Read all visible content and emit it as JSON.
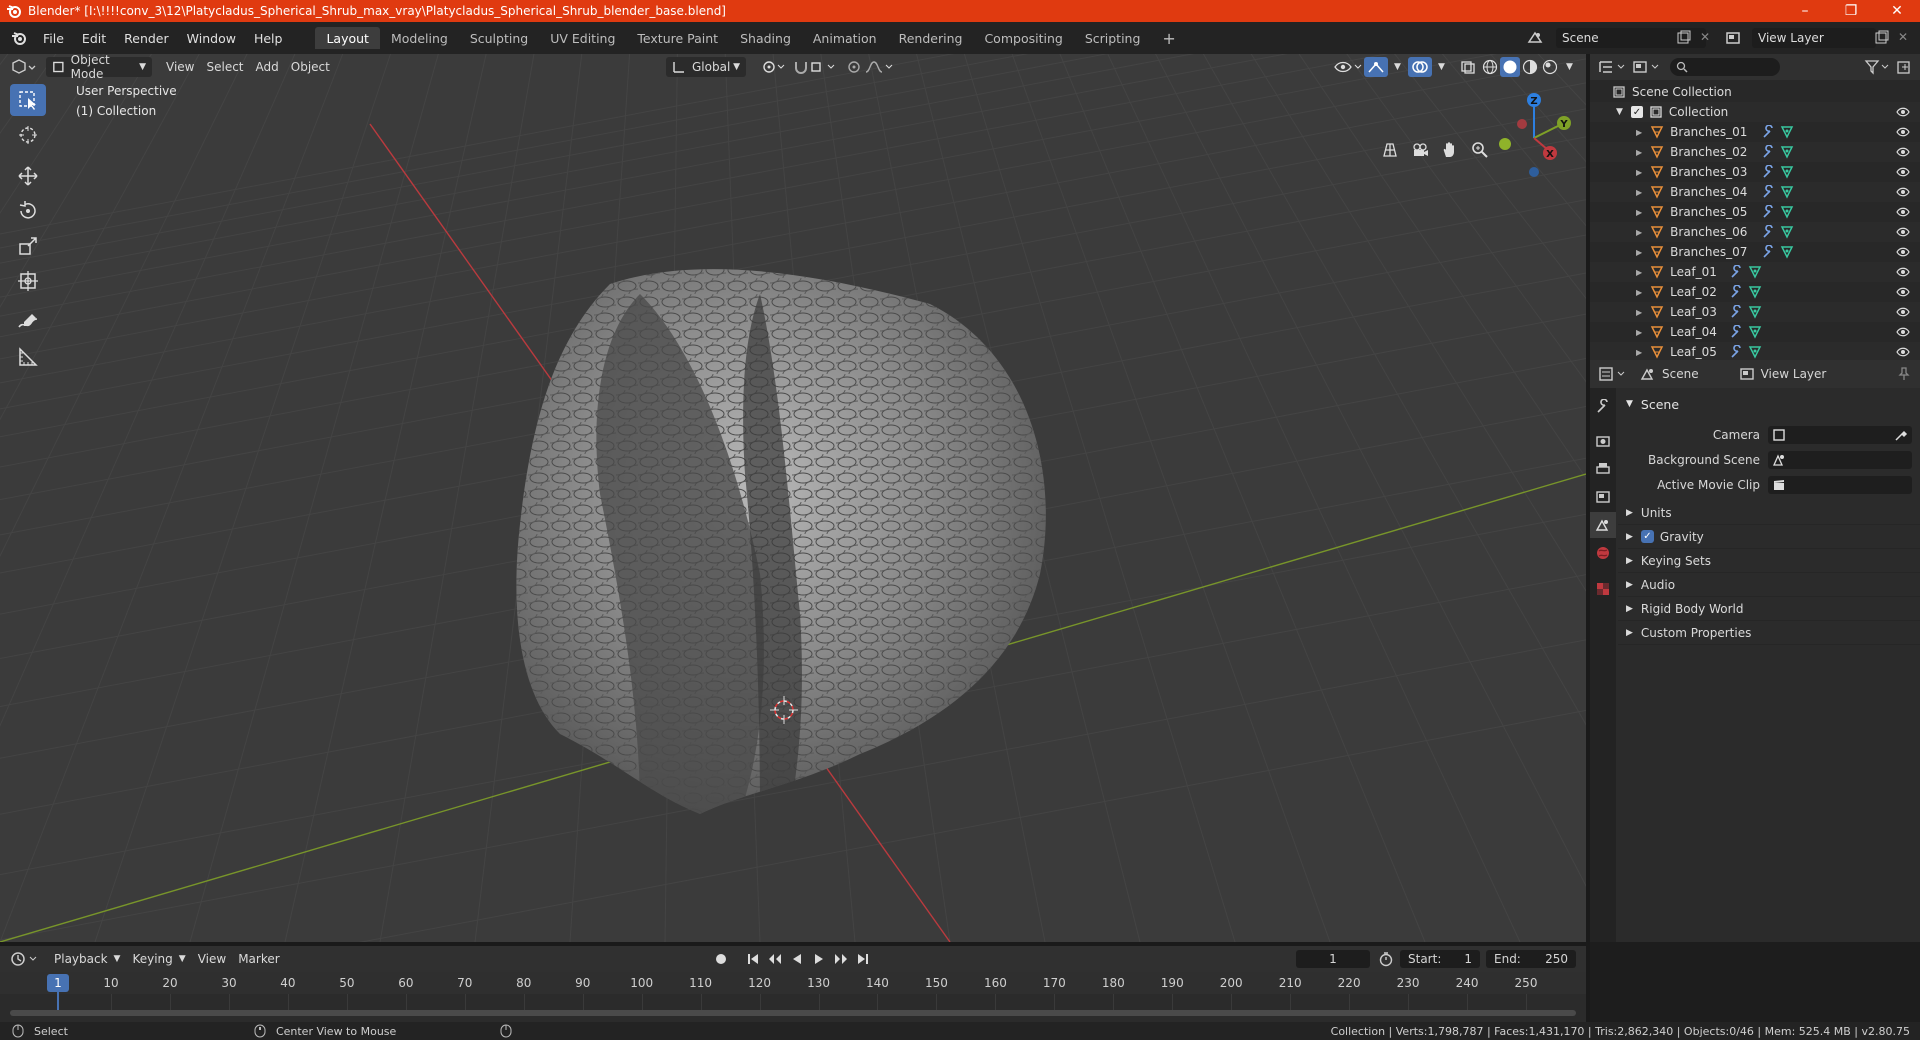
{
  "window": {
    "title": "Blender* [I:\\!!!!conv_3\\12\\Platycladus_Spherical_Shrub_max_vray\\Platycladus_Spherical_Shrub_blender_base.blend]",
    "minimize": "–",
    "maximize": "❐",
    "close": "✕"
  },
  "menu": [
    "File",
    "Edit",
    "Render",
    "Window",
    "Help"
  ],
  "workspaces": [
    "Layout",
    "Modeling",
    "Sculpting",
    "UV Editing",
    "Texture Paint",
    "Shading",
    "Animation",
    "Rendering",
    "Compositing",
    "Scripting"
  ],
  "active_workspace": "Layout",
  "scene_name": "Scene",
  "view_layer_name": "View Layer",
  "viewport": {
    "mode": "Object Mode",
    "menus": [
      "View",
      "Select",
      "Add",
      "Object"
    ],
    "transform_orientation": "Global",
    "perspective_label": "User Perspective",
    "collection_label": "(1) Collection",
    "gizmo": {
      "z": "Z",
      "y": "Y",
      "x": "X"
    }
  },
  "outliner": {
    "root": "Scene Collection",
    "collection": "Collection",
    "items": [
      "Branches_01",
      "Branches_02",
      "Branches_03",
      "Branches_04",
      "Branches_05",
      "Branches_06",
      "Branches_07",
      "Leaf_01",
      "Leaf_02",
      "Leaf_03",
      "Leaf_04",
      "Leaf_05"
    ]
  },
  "properties": {
    "tab_scene": "Scene",
    "tab_view_layer": "View Layer",
    "panel": "Scene",
    "camera_label": "Camera",
    "background_scene_label": "Background Scene",
    "active_movie_clip_label": "Active Movie Clip",
    "subpanels": [
      "Units",
      "Gravity",
      "Keying Sets",
      "Audio",
      "Rigid Body World",
      "Custom Properties"
    ],
    "gravity_checked": true
  },
  "timeline": {
    "menus": [
      "Playback",
      "Keying",
      "View",
      "Marker"
    ],
    "current_frame": "1",
    "start_label": "Start:",
    "start": "1",
    "end_label": "End:",
    "end": "250",
    "ticks": [
      "1",
      "10",
      "20",
      "30",
      "40",
      "50",
      "60",
      "70",
      "80",
      "90",
      "100",
      "110",
      "120",
      "130",
      "140",
      "150",
      "160",
      "170",
      "180",
      "190",
      "200",
      "210",
      "220",
      "230",
      "240",
      "250"
    ]
  },
  "status": {
    "left": "Select",
    "middle": "Center View to Mouse",
    "right": "Collection | Verts:1,798,787 | Faces:1,431,170 | Tris:2,862,340 | Objects:0/46 | Mem: 525.4 MB | v2.80.75"
  },
  "colors": {
    "accent": "#4772b3",
    "titlebar": "#e03a10",
    "x_axis": "#c0393f",
    "y_axis": "#7fa127",
    "z_axis": "#2d7fe0"
  }
}
